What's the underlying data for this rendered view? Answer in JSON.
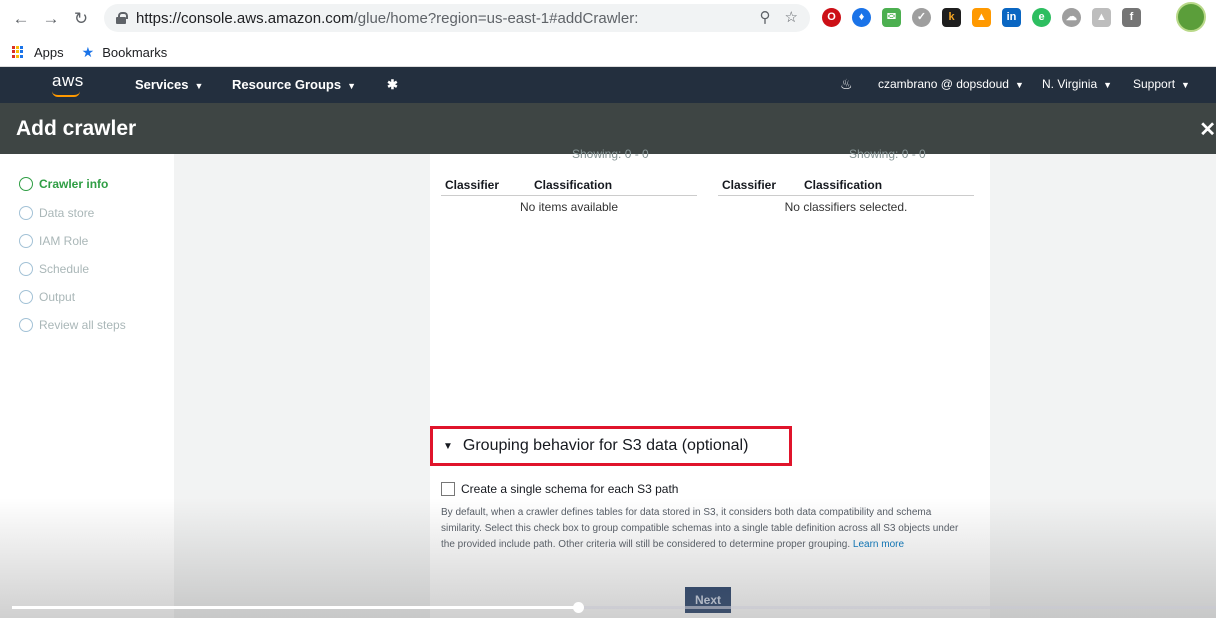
{
  "browser": {
    "url_host": "https://console.aws.amazon.com",
    "url_path": "/glue/home?region=us-east-1#addCrawler:",
    "bookmarks": [
      "Apps",
      "Bookmarks"
    ]
  },
  "aws_nav": {
    "logo": "aws",
    "services": "Services",
    "resource_groups": "Resource Groups",
    "user": "czambrano @ dopsdoud",
    "region": "N. Virginia",
    "support": "Support"
  },
  "page": {
    "title": "Add crawler"
  },
  "steps": [
    {
      "label": "Crawler info",
      "active": true
    },
    {
      "label": "Data store",
      "active": false
    },
    {
      "label": "IAM Role",
      "active": false
    },
    {
      "label": "Schedule",
      "active": false
    },
    {
      "label": "Output",
      "active": false
    },
    {
      "label": "Review all steps",
      "active": false
    }
  ],
  "classifiers": {
    "left": {
      "showing": "Showing: 0 - 0",
      "col1": "Classifier",
      "col2": "Classification",
      "empty": "No items available"
    },
    "right": {
      "showing": "Showing: 0 - 0",
      "col1": "Classifier",
      "col2": "Classification",
      "empty": "No classifiers selected."
    }
  },
  "grouping": {
    "title": "Grouping behavior for S3 data (optional)",
    "checkbox_label": "Create a single schema for each S3 path",
    "description": "By default, when a crawler defines tables for data stored in S3, it considers both data compatibility and schema similarity. Select this check box to group compatible schemas into a single table definition across all S3 objects under the provided include path. Other criteria will still be considered to determine proper grouping.",
    "learn_more": "Learn more"
  },
  "actions": {
    "next": "Next"
  },
  "video": {
    "progress": 0.47
  },
  "colors": {
    "aws_nav_bg": "#232f3e",
    "header_bg": "#3e4544",
    "active_step": "#2f9e44",
    "highlight_box": "#e0142b",
    "link": "#0073bb"
  }
}
